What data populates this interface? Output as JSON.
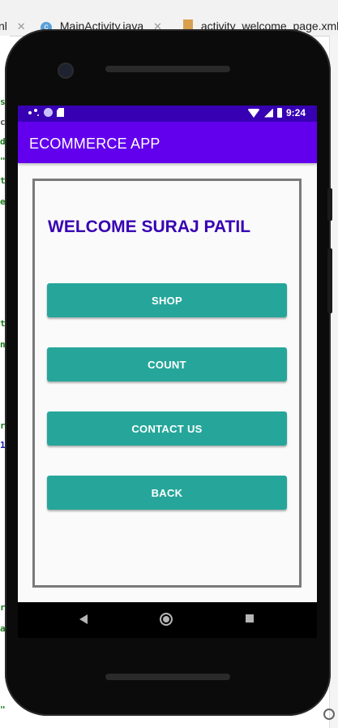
{
  "ide": {
    "tabs": [
      {
        "label": "nl"
      },
      {
        "label": "MainActivity.java"
      },
      {
        "label": "activity_welcome_page.xml"
      }
    ],
    "close_glyph": "✕",
    "code_fragments": [
      "s",
      "c",
      "d",
      "\"",
      "t",
      "e",
      "t",
      "n",
      "r",
      "1",
      "r",
      "a",
      "\""
    ]
  },
  "status_bar": {
    "time": "9:24",
    "color": "#3700b3"
  },
  "app_bar": {
    "title": "ECOMMERCE APP",
    "color": "#6200ee"
  },
  "main": {
    "welcome_text": "WELCOME SURAJ PATIL",
    "welcome_color": "#3700b3",
    "button_color": "#26a69a",
    "buttons": [
      {
        "label": "SHOP"
      },
      {
        "label": "COUNT"
      },
      {
        "label": "CONTACT US"
      },
      {
        "label": "BACK"
      }
    ]
  },
  "nav_bar": {
    "icons": [
      "back-icon",
      "home-icon",
      "recents-icon"
    ]
  }
}
